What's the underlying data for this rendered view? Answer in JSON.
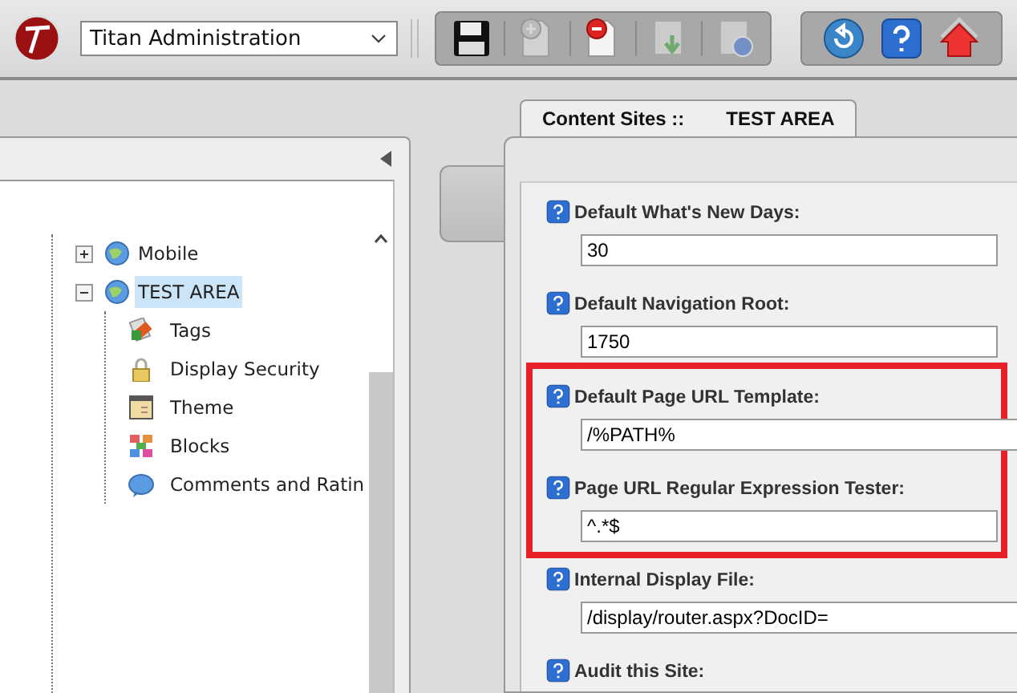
{
  "toolbar": {
    "app_select": {
      "value": "Titan Administration"
    },
    "groups": [
      {
        "buttons": [
          {
            "kind": "save",
            "disabled": false
          },
          {
            "kind": "add-page",
            "disabled": true
          },
          {
            "kind": "remove-page",
            "disabled": false
          },
          {
            "kind": "import",
            "disabled": true
          },
          {
            "kind": "publish",
            "disabled": true
          }
        ]
      },
      {
        "buttons": [
          {
            "kind": "refresh",
            "disabled": false
          },
          {
            "kind": "help",
            "disabled": false
          },
          {
            "kind": "home",
            "disabled": false
          }
        ]
      }
    ]
  },
  "tree": {
    "nodes": [
      {
        "label": "Mobile",
        "kind": "site",
        "expanded": false,
        "selected": false
      },
      {
        "label": "TEST AREA",
        "kind": "site",
        "expanded": true,
        "selected": true,
        "children": [
          {
            "label": "Tags",
            "kind": "tags",
            "selected": false
          },
          {
            "label": "Display Security",
            "kind": "lock",
            "selected": false
          },
          {
            "label": "Theme",
            "kind": "theme",
            "selected": false
          },
          {
            "label": "Blocks",
            "kind": "blocks",
            "selected": false
          },
          {
            "label": "Comments and Ratin",
            "kind": "comments",
            "selected": false
          }
        ]
      }
    ]
  },
  "tab": {
    "label": "Content Sites ::",
    "site": "TEST AREA"
  },
  "fields": [
    {
      "label": "Default What's New Days:",
      "value": "30",
      "highlighted": false,
      "wide": false
    },
    {
      "label": "Default Navigation Root:",
      "value": "1750",
      "highlighted": false,
      "wide": false
    },
    {
      "label": "Default Page URL Template:",
      "value": "/%PATH%",
      "highlighted": true,
      "wide": true
    },
    {
      "label": "Page URL Regular Expression Tester:",
      "value": "^.*$",
      "highlighted": true,
      "wide": false
    },
    {
      "label": "Internal Display File:",
      "value": "/display/router.aspx?DocID=",
      "highlighted": false,
      "wide": true
    },
    {
      "label": "Audit this Site:",
      "highlighted": false
    }
  ]
}
